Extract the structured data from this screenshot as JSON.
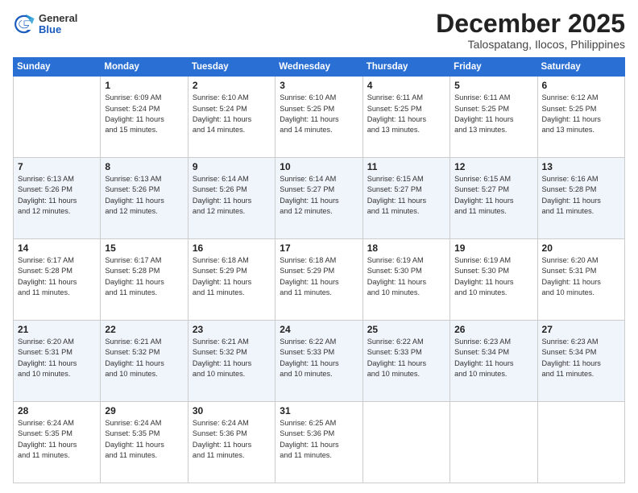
{
  "header": {
    "logo_general": "General",
    "logo_blue": "Blue",
    "month": "December 2025",
    "location": "Talospatang, Ilocos, Philippines"
  },
  "weekdays": [
    "Sunday",
    "Monday",
    "Tuesday",
    "Wednesday",
    "Thursday",
    "Friday",
    "Saturday"
  ],
  "weeks": [
    [
      {
        "day": "",
        "info": ""
      },
      {
        "day": "1",
        "info": "Sunrise: 6:09 AM\nSunset: 5:24 PM\nDaylight: 11 hours\nand 15 minutes."
      },
      {
        "day": "2",
        "info": "Sunrise: 6:10 AM\nSunset: 5:24 PM\nDaylight: 11 hours\nand 14 minutes."
      },
      {
        "day": "3",
        "info": "Sunrise: 6:10 AM\nSunset: 5:25 PM\nDaylight: 11 hours\nand 14 minutes."
      },
      {
        "day": "4",
        "info": "Sunrise: 6:11 AM\nSunset: 5:25 PM\nDaylight: 11 hours\nand 13 minutes."
      },
      {
        "day": "5",
        "info": "Sunrise: 6:11 AM\nSunset: 5:25 PM\nDaylight: 11 hours\nand 13 minutes."
      },
      {
        "day": "6",
        "info": "Sunrise: 6:12 AM\nSunset: 5:25 PM\nDaylight: 11 hours\nand 13 minutes."
      }
    ],
    [
      {
        "day": "7",
        "info": "Sunrise: 6:13 AM\nSunset: 5:26 PM\nDaylight: 11 hours\nand 12 minutes."
      },
      {
        "day": "8",
        "info": "Sunrise: 6:13 AM\nSunset: 5:26 PM\nDaylight: 11 hours\nand 12 minutes."
      },
      {
        "day": "9",
        "info": "Sunrise: 6:14 AM\nSunset: 5:26 PM\nDaylight: 11 hours\nand 12 minutes."
      },
      {
        "day": "10",
        "info": "Sunrise: 6:14 AM\nSunset: 5:27 PM\nDaylight: 11 hours\nand 12 minutes."
      },
      {
        "day": "11",
        "info": "Sunrise: 6:15 AM\nSunset: 5:27 PM\nDaylight: 11 hours\nand 11 minutes."
      },
      {
        "day": "12",
        "info": "Sunrise: 6:15 AM\nSunset: 5:27 PM\nDaylight: 11 hours\nand 11 minutes."
      },
      {
        "day": "13",
        "info": "Sunrise: 6:16 AM\nSunset: 5:28 PM\nDaylight: 11 hours\nand 11 minutes."
      }
    ],
    [
      {
        "day": "14",
        "info": "Sunrise: 6:17 AM\nSunset: 5:28 PM\nDaylight: 11 hours\nand 11 minutes."
      },
      {
        "day": "15",
        "info": "Sunrise: 6:17 AM\nSunset: 5:28 PM\nDaylight: 11 hours\nand 11 minutes."
      },
      {
        "day": "16",
        "info": "Sunrise: 6:18 AM\nSunset: 5:29 PM\nDaylight: 11 hours\nand 11 minutes."
      },
      {
        "day": "17",
        "info": "Sunrise: 6:18 AM\nSunset: 5:29 PM\nDaylight: 11 hours\nand 11 minutes."
      },
      {
        "day": "18",
        "info": "Sunrise: 6:19 AM\nSunset: 5:30 PM\nDaylight: 11 hours\nand 10 minutes."
      },
      {
        "day": "19",
        "info": "Sunrise: 6:19 AM\nSunset: 5:30 PM\nDaylight: 11 hours\nand 10 minutes."
      },
      {
        "day": "20",
        "info": "Sunrise: 6:20 AM\nSunset: 5:31 PM\nDaylight: 11 hours\nand 10 minutes."
      }
    ],
    [
      {
        "day": "21",
        "info": "Sunrise: 6:20 AM\nSunset: 5:31 PM\nDaylight: 11 hours\nand 10 minutes."
      },
      {
        "day": "22",
        "info": "Sunrise: 6:21 AM\nSunset: 5:32 PM\nDaylight: 11 hours\nand 10 minutes."
      },
      {
        "day": "23",
        "info": "Sunrise: 6:21 AM\nSunset: 5:32 PM\nDaylight: 11 hours\nand 10 minutes."
      },
      {
        "day": "24",
        "info": "Sunrise: 6:22 AM\nSunset: 5:33 PM\nDaylight: 11 hours\nand 10 minutes."
      },
      {
        "day": "25",
        "info": "Sunrise: 6:22 AM\nSunset: 5:33 PM\nDaylight: 11 hours\nand 10 minutes."
      },
      {
        "day": "26",
        "info": "Sunrise: 6:23 AM\nSunset: 5:34 PM\nDaylight: 11 hours\nand 10 minutes."
      },
      {
        "day": "27",
        "info": "Sunrise: 6:23 AM\nSunset: 5:34 PM\nDaylight: 11 hours\nand 11 minutes."
      }
    ],
    [
      {
        "day": "28",
        "info": "Sunrise: 6:24 AM\nSunset: 5:35 PM\nDaylight: 11 hours\nand 11 minutes."
      },
      {
        "day": "29",
        "info": "Sunrise: 6:24 AM\nSunset: 5:35 PM\nDaylight: 11 hours\nand 11 minutes."
      },
      {
        "day": "30",
        "info": "Sunrise: 6:24 AM\nSunset: 5:36 PM\nDaylight: 11 hours\nand 11 minutes."
      },
      {
        "day": "31",
        "info": "Sunrise: 6:25 AM\nSunset: 5:36 PM\nDaylight: 11 hours\nand 11 minutes."
      },
      {
        "day": "",
        "info": ""
      },
      {
        "day": "",
        "info": ""
      },
      {
        "day": "",
        "info": ""
      }
    ]
  ]
}
